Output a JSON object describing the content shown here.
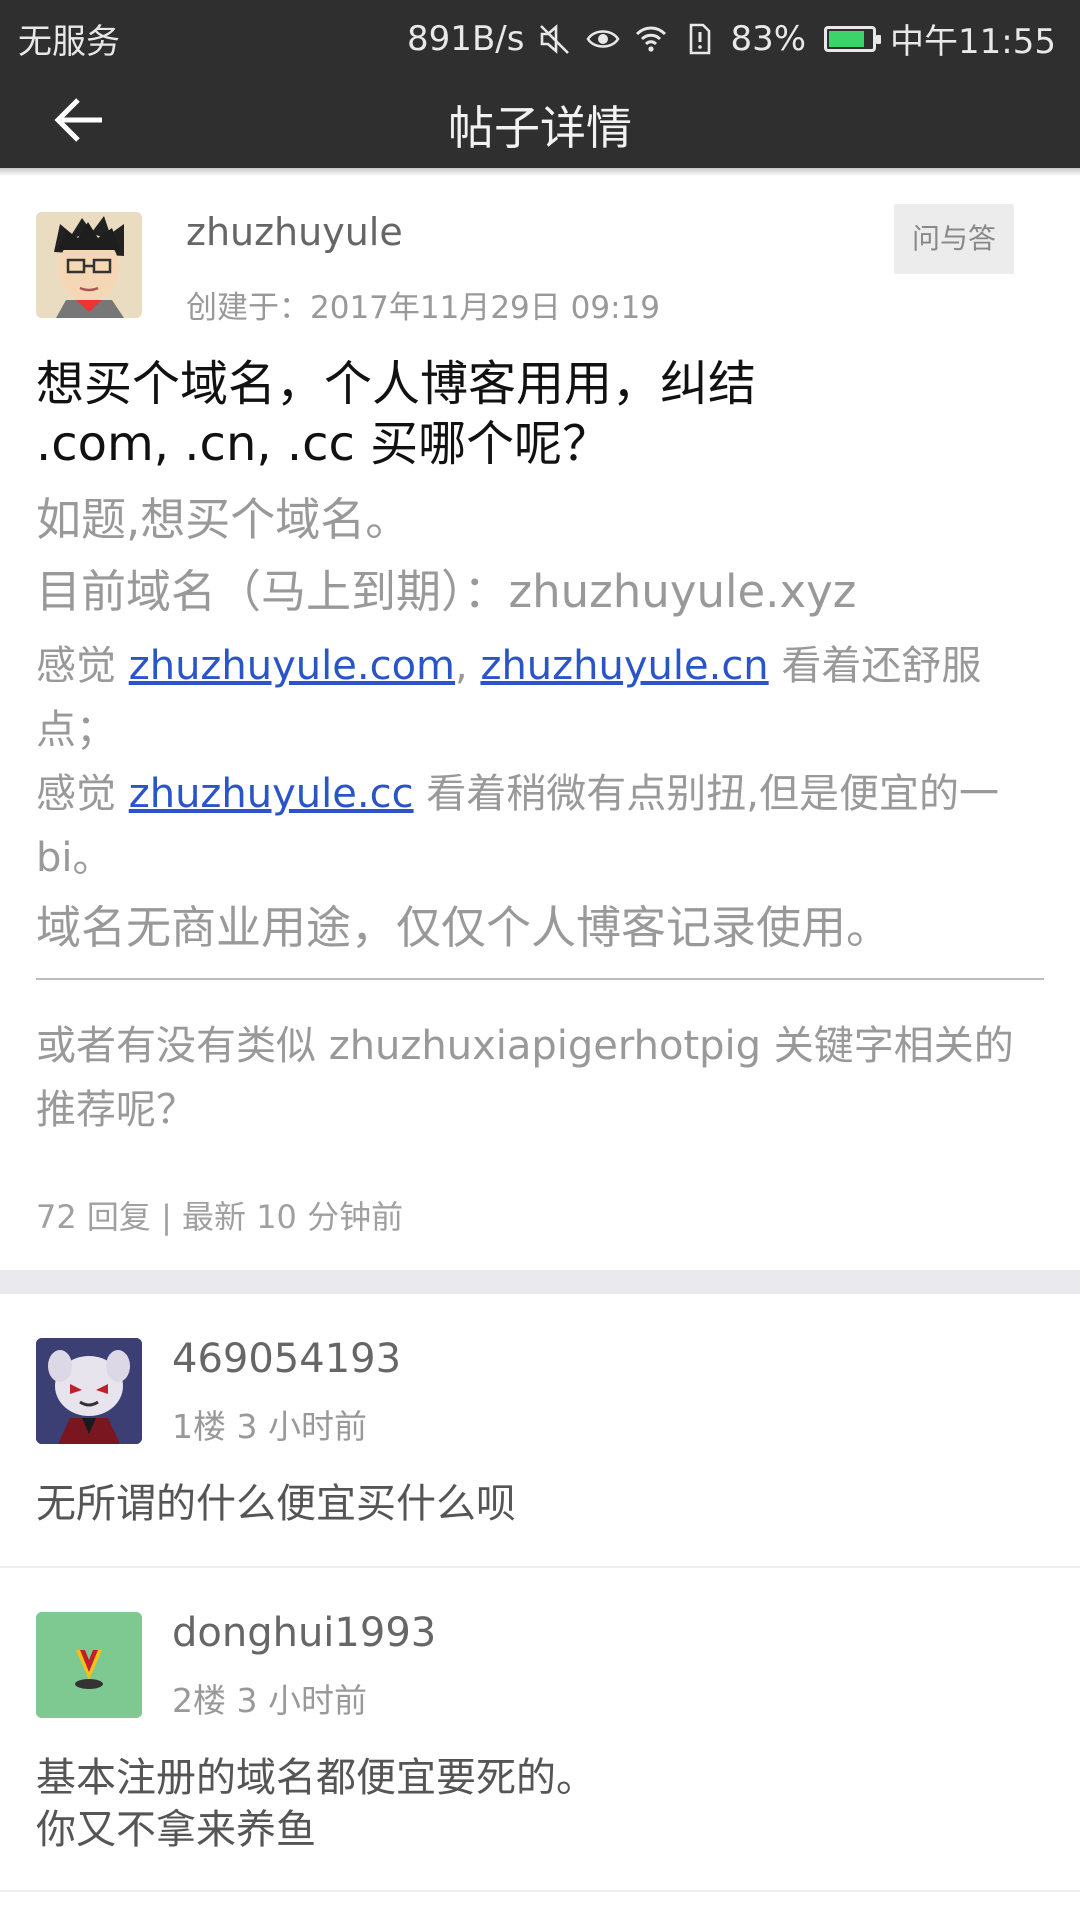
{
  "status_bar": {
    "carrier": "无服务",
    "net_speed": "891B/s",
    "battery_pct": "83%",
    "battery_level": 0.83,
    "time": "中午11:55",
    "icons": [
      "mute-icon",
      "eye-icon",
      "wifi-icon",
      "sim-alert-icon",
      "battery-icon"
    ]
  },
  "toolbar": {
    "title": "帖子详情",
    "back_icon": "arrow-left-icon"
  },
  "post": {
    "author": "zhuzhuyule",
    "created": "创建于：2017年11月29日 09:19",
    "tag": "问与答",
    "title": "想买个域名，个人博客用用，纠结 .com, .cn, .cc 买哪个呢？",
    "line1": "如题,想买个域名。",
    "line2": "目前域名（马上到期）：zhuzhuyule.xyz",
    "line3_prefix": "感觉 ",
    "line3_link1": "zhuzhuyule.com",
    "line3_sep": ", ",
    "line3_link2": "zhuzhuyule.cn",
    "line3_suffix": " 看着还舒服点；",
    "line4_prefix": "感觉 ",
    "line4_link": "zhuzhuyule.cc",
    "line4_suffix": " 看着稍微有点别扭,但是便宜的一bi。",
    "line5": "域名无商业用途，仅仅个人博客记录使用。",
    "line6": "或者有没有类似 zhuzhuxiapigerhotpig 关键字相关的推荐呢？",
    "stats": "72 回复 | 最新 10 分钟前"
  },
  "replies": [
    {
      "user": "469054193",
      "meta": "1楼 3 小时前",
      "text": "无所谓的什么便宜买什么呗"
    },
    {
      "user": "donghui1993",
      "meta": "2楼 3 小时前",
      "text_line1": "基本注册的域名都便宜要死的。",
      "text_line2": "你又不拿来养鱼"
    }
  ],
  "colors": {
    "bar": "#2f2f2f",
    "link": "#2a55c9",
    "battery": "#3bd36a",
    "avatar3": "#7ec992"
  }
}
